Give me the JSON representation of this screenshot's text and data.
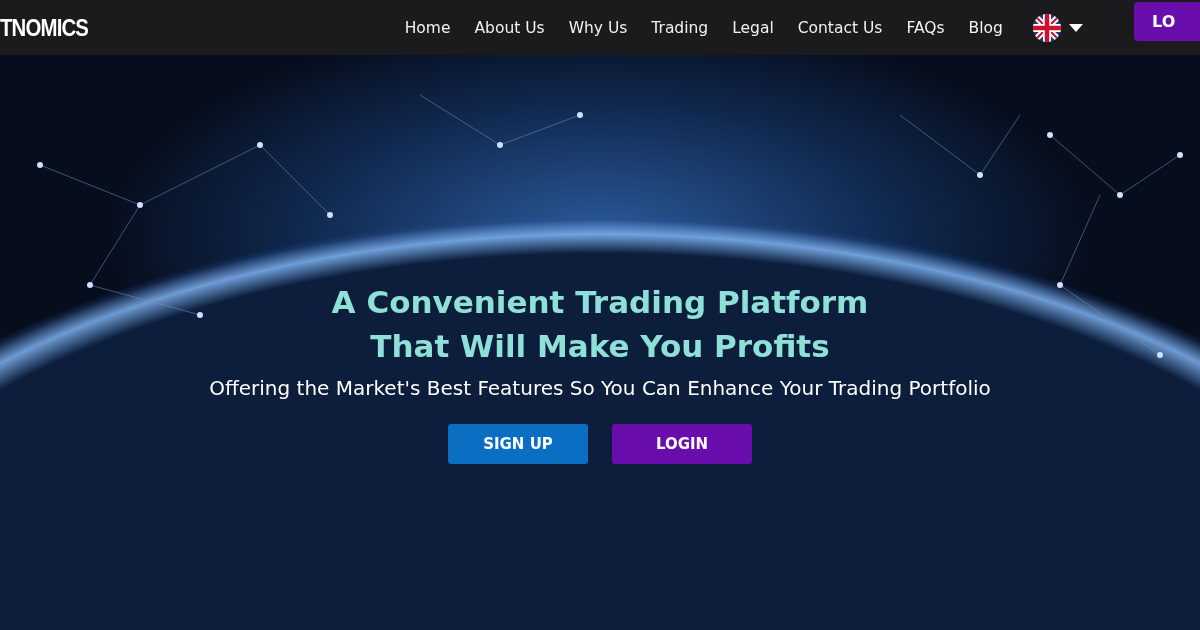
{
  "header": {
    "logo": "TNOMICS",
    "nav": [
      {
        "label": "Home"
      },
      {
        "label": "About Us"
      },
      {
        "label": "Why Us"
      },
      {
        "label": "Trading"
      },
      {
        "label": "Legal"
      },
      {
        "label": "Contact Us"
      },
      {
        "label": "FAQs"
      },
      {
        "label": "Blog"
      }
    ],
    "login_button": "LO"
  },
  "hero": {
    "title_lines": [
      "A Convenient Trading Platform",
      "That Will Make You Profits"
    ],
    "subtitle": "Offering the Market's Best Features So You Can Enhance Your Trading Portfolio",
    "buttons": [
      {
        "label": "SIGN UP",
        "kind": "signup"
      },
      {
        "label": "LOGIN",
        "kind": "login"
      }
    ]
  }
}
